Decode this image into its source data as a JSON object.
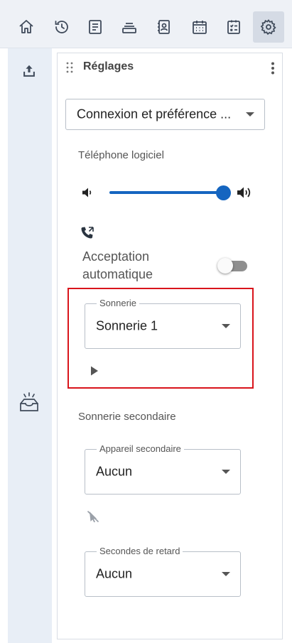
{
  "topbar": {
    "items": [
      {
        "icon": "home-icon",
        "active": false
      },
      {
        "icon": "history-icon",
        "active": false
      },
      {
        "icon": "notes-icon",
        "active": false
      },
      {
        "icon": "queue-icon",
        "active": false
      },
      {
        "icon": "contacts-icon",
        "active": false
      },
      {
        "icon": "calendar-icon",
        "active": false
      },
      {
        "icon": "tasks-icon",
        "active": false
      },
      {
        "icon": "settings-icon",
        "active": true
      }
    ],
    "active_bg": "#d5dbe5"
  },
  "panel": {
    "title": "Réglages",
    "section_select": "Connexion et préférence ...",
    "softphone": {
      "heading": "Téléphone logiciel",
      "volume_level": 0.95,
      "auto_accept_label": "Acceptation automatique",
      "auto_accept_on": false,
      "ringtone": {
        "legend": "Sonnerie",
        "value": "Sonnerie 1"
      }
    },
    "secondary": {
      "heading": "Sonnerie secondaire",
      "device": {
        "legend": "Appareil secondaire",
        "value": "Aucun"
      },
      "delay": {
        "legend": "Secondes de retard",
        "value": "Aucun"
      }
    }
  },
  "colors": {
    "accent": "#1565c0",
    "highlight": "#d9141b",
    "icon": "#3f4a5a"
  }
}
